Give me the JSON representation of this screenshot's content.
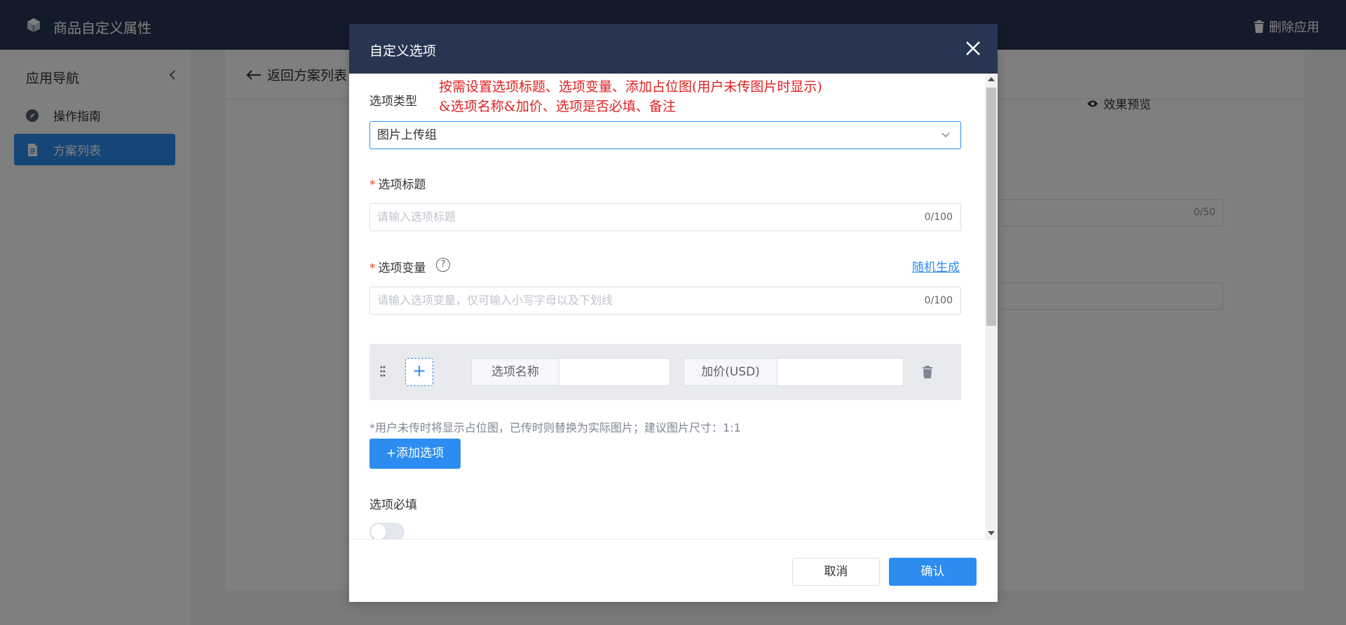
{
  "topbar": {
    "app_title": "商品自定义属性",
    "delete_app": "删除应用"
  },
  "sidebar": {
    "title": "应用导航",
    "items": [
      {
        "label": "操作指南",
        "icon": "compass-icon"
      },
      {
        "label": "方案列表",
        "icon": "document-icon",
        "active": true
      }
    ]
  },
  "content": {
    "back_label": "返回方案列表",
    "preview_label": "效果预览",
    "counter": "0/50"
  },
  "modal": {
    "title": "自定义选项",
    "annotation": [
      "按需设置选项标题、选项变量、添加占位图(用户未传图片时显示)",
      "&选项名称&加价、选项是否必填、备注"
    ],
    "type_label": "选项类型",
    "type_value": "图片上传组",
    "required_mark": "*",
    "title_label": "选项标题",
    "title_placeholder": "请输入选项标题",
    "title_count": "0/100",
    "variable_label": "选项变量",
    "help_glyph": "?",
    "random_generate": "随机生成",
    "variable_placeholder": "请输入选项变量，仅可输入小写字母以及下划线",
    "variable_count": "0/100",
    "option_name_label": "选项名称",
    "price_label": "加价(USD)",
    "option_name_value": "",
    "price_value": "",
    "hint": "*用户未传时将显示占位图，已传时则替换为实际图片；建议图片尺寸：1:1",
    "add_option": "+添加选项",
    "required_toggle_label": "选项必填",
    "required_toggle_on": false,
    "cancel": "取消",
    "confirm": "确认"
  },
  "colors": {
    "header_bg": "#273452",
    "primary": "#2d8cf0",
    "annotation": "#e02020",
    "required": "#ed4014"
  }
}
